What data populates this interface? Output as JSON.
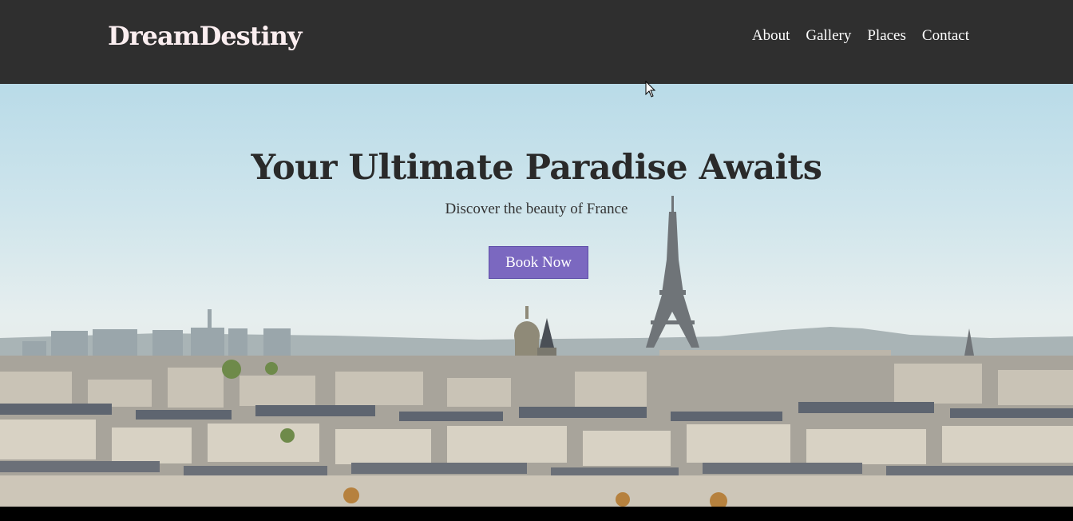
{
  "header": {
    "logo": "DreamDestiny",
    "nav": [
      "About",
      "Gallery",
      "Places",
      "Contact"
    ]
  },
  "hero": {
    "title": "Your Ultimate Paradise Awaits",
    "subtitle": "Discover the beauty of France",
    "cta_label": "Book Now"
  },
  "colors": {
    "header_bg": "#2f2f2f",
    "button_bg": "#7b68c0",
    "logo_color": "#fbeef0"
  },
  "icons": [
    "cursor-icon",
    "eiffel-tower-illustration",
    "paris-skyline-illustration"
  ]
}
